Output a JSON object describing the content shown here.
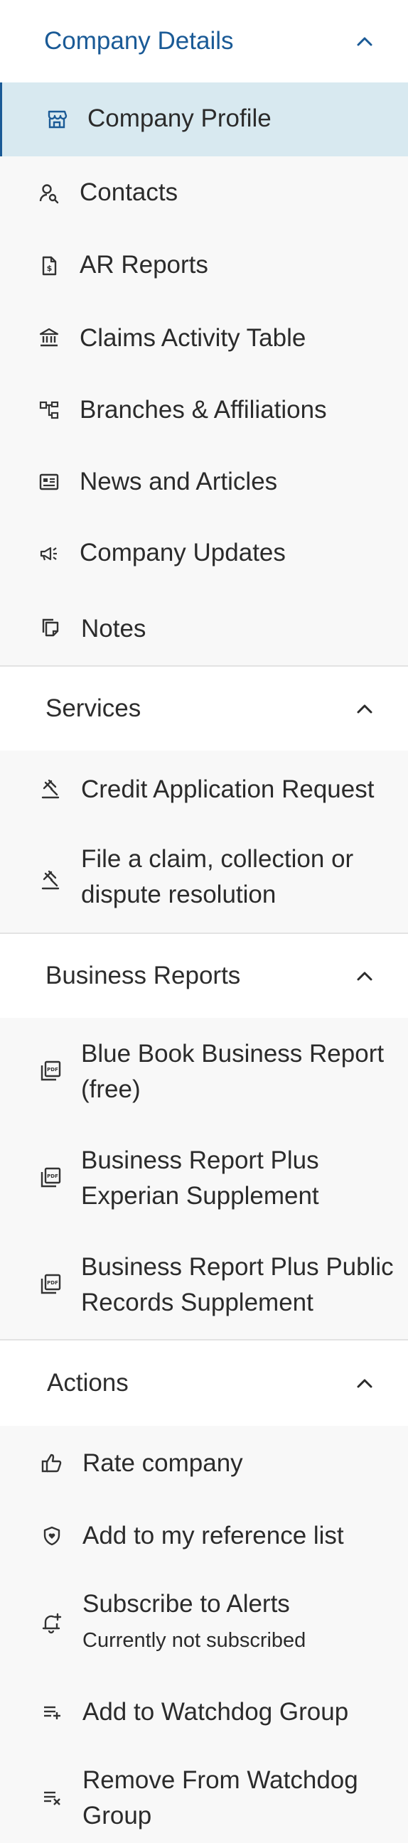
{
  "sections": {
    "company_details": {
      "title": "Company Details",
      "items": [
        {
          "label": "Company Profile",
          "icon": "storefront-icon",
          "active": true
        },
        {
          "label": "Contacts",
          "icon": "person-search-icon"
        },
        {
          "label": "AR Reports",
          "icon": "dollar-document-icon"
        },
        {
          "label": "Claims Activity Table",
          "icon": "bank-icon"
        },
        {
          "label": "Branches & Affiliations",
          "icon": "hierarchy-icon"
        },
        {
          "label": "News and Articles",
          "icon": "newspaper-icon"
        },
        {
          "label": "Company Updates",
          "icon": "megaphone-icon"
        },
        {
          "label": "Notes",
          "icon": "note-copy-icon"
        }
      ]
    },
    "services": {
      "title": "Services",
      "items": [
        {
          "label": "Credit Application Request",
          "icon": "gavel-icon"
        },
        {
          "label_line1": "File a claim, collection or",
          "label_line2": "dispute resolution",
          "icon": "gavel-icon"
        }
      ]
    },
    "business_reports": {
      "title": "Business Reports",
      "items": [
        {
          "label_line1": "Blue Book Business Report",
          "label_line2": "(free)",
          "icon": "pdf-icon"
        },
        {
          "label_line1": "Business Report Plus",
          "label_line2": "Experian Supplement",
          "icon": "pdf-icon"
        },
        {
          "label_line1": "Business Report Plus Public",
          "label_line2": "Records Supplement",
          "icon": "pdf-icon"
        }
      ]
    },
    "actions": {
      "title": "Actions",
      "items": [
        {
          "label": "Rate company",
          "icon": "thumbs-up-icon"
        },
        {
          "label": "Add to my reference list",
          "icon": "shield-heart-icon"
        },
        {
          "label": "Subscribe to Alerts",
          "sublabel": "Currently not subscribed",
          "icon": "bell-plus-icon"
        },
        {
          "label": "Add to Watchdog Group",
          "icon": "playlist-add-icon"
        },
        {
          "label_line1": "Remove From Watchdog",
          "label_line2": "Group",
          "icon": "playlist-remove-icon"
        }
      ]
    }
  },
  "colors": {
    "accent": "#1a5a96",
    "active_bg": "#d8e9f0",
    "text": "#2b2b2b",
    "background": "#f8f8f8",
    "header_bg": "#ffffff"
  }
}
